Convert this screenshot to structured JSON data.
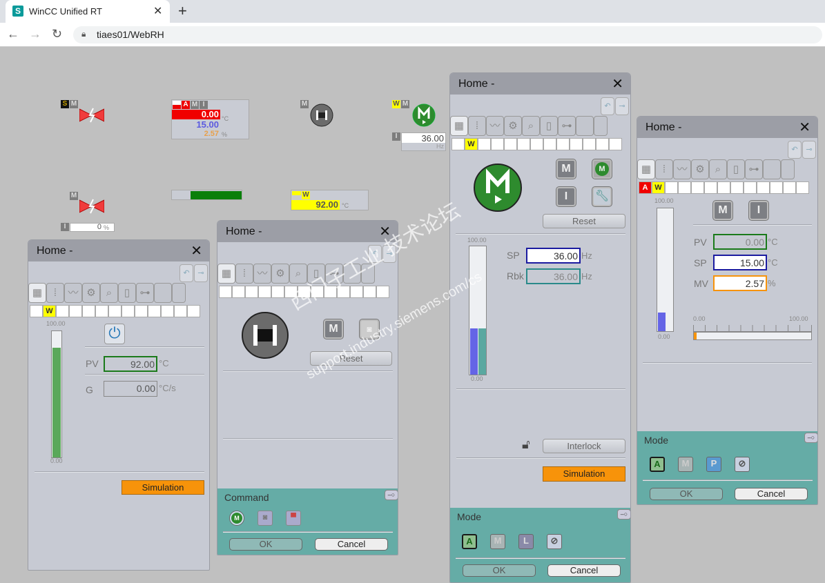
{
  "browser": {
    "tab_title": "WinCC Unified RT",
    "favicon": "S",
    "url": "tiaes01/WebRH"
  },
  "objects": {
    "valve1": {
      "badges": [
        "S",
        "M"
      ]
    },
    "valve2": {
      "badges": [
        "M"
      ],
      "interlock": "I",
      "value": "0",
      "unit": "%"
    },
    "pid": {
      "badges": [
        "A",
        "M",
        "I"
      ],
      "pv": "0.00",
      "sp": "15.00",
      "mv": "2.57",
      "unit_temp": "°C",
      "unit_pct": "%"
    },
    "motor_gray": {
      "badges": [
        "M"
      ]
    },
    "motor_green": {
      "badges": [
        "W",
        "M"
      ],
      "interlock": "I",
      "value": "36.00",
      "unit": "Hz"
    },
    "analog": {
      "badges": [
        "W"
      ],
      "value": "92.00",
      "unit": "°C"
    },
    "bar": {
      "level_pct": 100
    }
  },
  "panels": [
    {
      "title": "Home -",
      "cells": [
        "",
        "W",
        "",
        "",
        "",
        "",
        "",
        "",
        "",
        "",
        "",
        "",
        ""
      ],
      "gauge_max": "100.00",
      "gauge_min": "0.00",
      "gauge_level_pct": 87,
      "pv_label": "PV",
      "pv": "92.00",
      "pv_unit": "°C",
      "g_label": "G",
      "g": "0.00",
      "g_unit": "°C/s",
      "simulation": "Simulation"
    },
    {
      "title": "Home -",
      "cells": [
        "",
        "",
        "",
        "",
        "",
        "",
        "",
        "",
        "",
        "",
        "",
        "",
        ""
      ],
      "reset": "Reset",
      "command_title": "Command",
      "ok": "OK",
      "cancel": "Cancel"
    },
    {
      "title": "Home -",
      "cells": [
        "",
        "W",
        "",
        "",
        "",
        "",
        "",
        "",
        "",
        "",
        "",
        "",
        ""
      ],
      "reset": "Reset",
      "gauge_max": "100.00",
      "gauge_min": "0.00",
      "sp_level_pct": 36,
      "rbk_level_pct": 36,
      "sp_label": "SP",
      "sp": "36.00",
      "sp_unit": "Hz",
      "rbk_label": "Rbk",
      "rbk": "36.00",
      "rbk_unit": "Hz",
      "interlock": "Interlock",
      "simulation": "Simulation",
      "mode_title": "Mode",
      "modes": [
        "A",
        "M",
        "L"
      ],
      "ok": "OK",
      "cancel": "Cancel"
    },
    {
      "title": "Home -",
      "cells": [
        "A",
        "W",
        "",
        "",
        "",
        "",
        "",
        "",
        "",
        "",
        "",
        "",
        ""
      ],
      "gauge_max": "100.00",
      "gauge_min": "0.00",
      "gauge_level_pct": 15,
      "pv_label": "PV",
      "pv": "0.00",
      "pv_unit": "°C",
      "sp_label": "SP",
      "sp": "15.00",
      "sp_unit": "°C",
      "mv_label": "MV",
      "mv": "2.57",
      "mv_unit": "%",
      "scale_min": "0.00",
      "scale_max": "100.00",
      "mv_level_pct": 2.57,
      "mode_title": "Mode",
      "modes": [
        "A",
        "M",
        "P"
      ],
      "ok": "OK",
      "cancel": "Cancel"
    }
  ],
  "toolbar_icons": [
    "grid-icon",
    "scale-icon",
    "trend-icon",
    "gear-icon",
    "search-doc-icon",
    "page-icon",
    "hierarchy-icon",
    "",
    ""
  ],
  "colors": {
    "alarm_red": "#f00000",
    "warning_yellow": "#ffff00",
    "motor_green": "#2e8b2e",
    "teal": "#65aca6",
    "orange": "#f7930a"
  },
  "watermark": {
    "line1": "西门子工业 技术论坛",
    "line2": "support.industry.siemens.com/cs"
  }
}
